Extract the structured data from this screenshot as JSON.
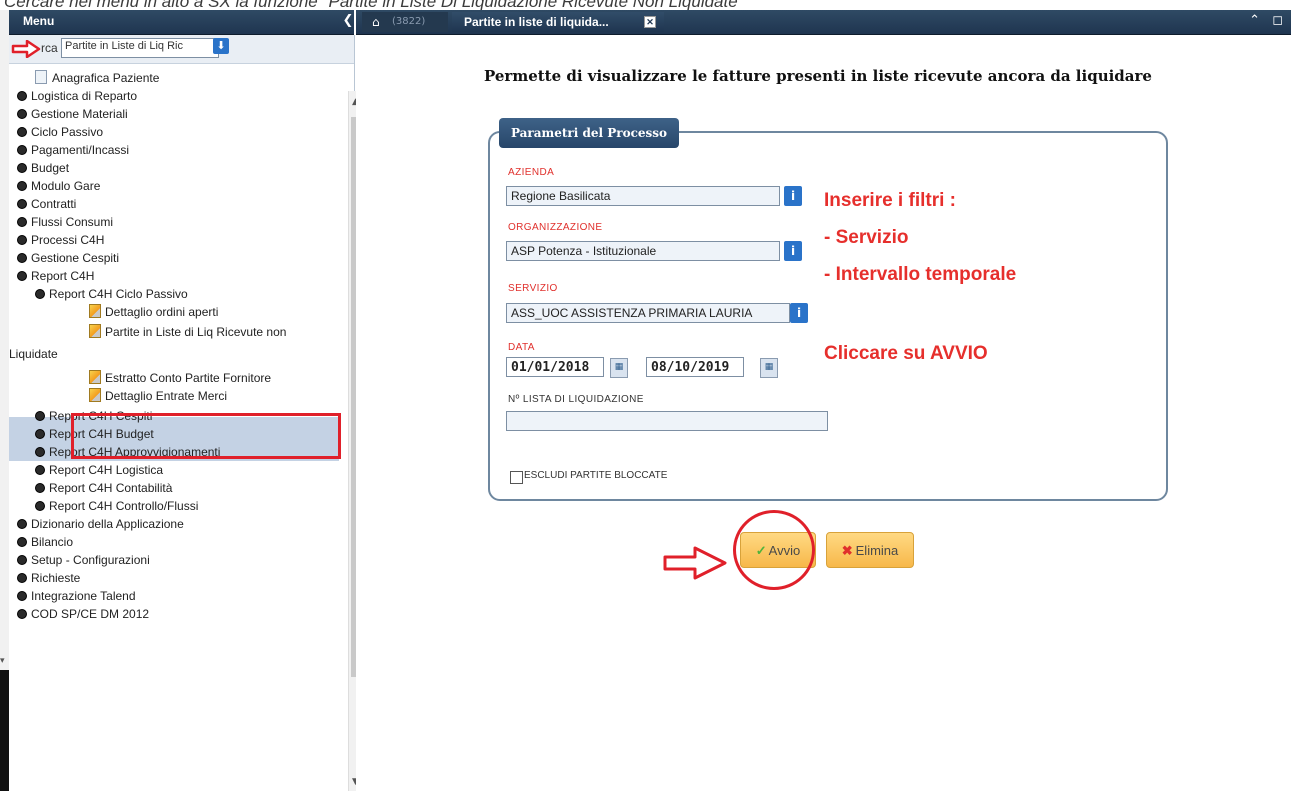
{
  "caption": "Cercare nel menù in alto a SX  la funzione \"Partite in Liste Di Liquidazione Ricevute Non Liquidate\"",
  "sidebar": {
    "title": "Menu",
    "collapse_glyph": "❮",
    "search_prefix": "rca",
    "search_value": "Partite in Liste di Liq Ric",
    "items": [
      {
        "label": "Anagrafica Paziente"
      },
      {
        "label": "Logistica di Reparto"
      },
      {
        "label": "Gestione Materiali"
      },
      {
        "label": "Ciclo Passivo"
      },
      {
        "label": "Pagamenti/Incassi"
      },
      {
        "label": "Budget"
      },
      {
        "label": "Modulo Gare"
      },
      {
        "label": "Contratti"
      },
      {
        "label": "Flussi Consumi"
      },
      {
        "label": "Processi C4H"
      },
      {
        "label": "Gestione Cespiti"
      },
      {
        "label": "Report C4H"
      },
      {
        "label": "Report C4H Ciclo Passivo"
      },
      {
        "label": "Dettaglio ordini aperti"
      },
      {
        "label": "Partite in Liste di Liq Ricevute non"
      },
      {
        "label": "Liquidate"
      },
      {
        "label": "Estratto Conto Partite Fornitore"
      },
      {
        "label": "Dettaglio Entrate Merci"
      },
      {
        "label": "Report C4H Cespiti"
      },
      {
        "label": "Report C4H Budget"
      },
      {
        "label": "Report C4H Approvvigionamenti"
      },
      {
        "label": "Report C4H Logistica"
      },
      {
        "label": "Report C4H Contabilità"
      },
      {
        "label": "Report C4H Controllo/Flussi"
      },
      {
        "label": "Dizionario della Applicazione"
      },
      {
        "label": "Bilancio"
      },
      {
        "label": "Setup - Configurazioni"
      },
      {
        "label": "Richieste"
      },
      {
        "label": "Integrazione Talend"
      },
      {
        "label": "COD SP/CE DM 2012"
      }
    ]
  },
  "tabs": {
    "home_count": "(3822)",
    "active_label": "Partite in liste di liquida..."
  },
  "main": {
    "heading": "Permette di visualizzare le fatture presenti in liste ricevute ancora da liquidare",
    "group_title": "Parametri del Processo",
    "fields": {
      "azienda_label": "AZIENDA",
      "azienda_value": "Regione Basilicata",
      "organizzazione_label": "ORGANIZZAZIONE",
      "organizzazione_value": "ASP Potenza - Istituzionale",
      "servizio_label": "SERVIZIO",
      "servizio_value": "ASS_UOC ASSISTENZA PRIMARIA LAURIA",
      "data_label": "DATA",
      "data_from": "01/01/2018",
      "data_to": "08/10/2019",
      "lista_label": "Nº LISTA DI LIQUIDAZIONE",
      "lista_value": "",
      "escludi_label": "ESCLUDI PARTITE BLOCCATE"
    },
    "annotations": {
      "line1": "Inserire i filtri :",
      "line2": "- Servizio",
      "line3": "- Intervallo temporale",
      "line4": "Cliccare su AVVIO"
    },
    "buttons": {
      "avvio": "Avvio",
      "elimina": "Elimina"
    }
  },
  "colors": {
    "topbar": "#1f3550",
    "annotation_red": "#e62f2c",
    "button_orange": "#f7b84a",
    "group_title_blue": "#27466a"
  }
}
